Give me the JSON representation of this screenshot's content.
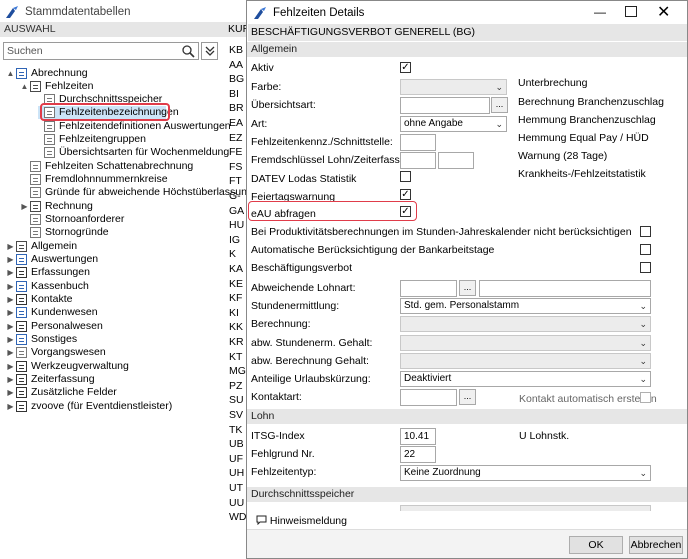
{
  "left_window": {
    "title": "Stammdatentabellen",
    "section": "AUSWAHL",
    "search_placeholder": "Suchen",
    "column_header": "KURZ"
  },
  "tree": [
    {
      "label": "Abrechnung",
      "icon": "book-icon",
      "expander": "▲"
    },
    {
      "label": "Fehlzeiten",
      "icon": "table-icon",
      "expander": "▲"
    },
    {
      "label": "Durchschnittsspeicher",
      "icon": "doc-icon",
      "expander": ""
    },
    {
      "label": "Fehlzeitenbezeichnungen",
      "icon": "doc-icon",
      "expander": ""
    },
    {
      "label": "Fehlzeitendefinitionen Auswertungen",
      "icon": "doc-icon",
      "expander": ""
    },
    {
      "label": "Fehlzeitengruppen",
      "icon": "doc-icon",
      "expander": ""
    },
    {
      "label": "Übersichtsarten für Wochenmeldung",
      "icon": "doc-icon",
      "expander": ""
    },
    {
      "label": "Fehlzeiten Schattenabrechnung",
      "icon": "doc-icon",
      "expander": ""
    },
    {
      "label": "Fremdlohnnummernkreise",
      "icon": "doc-icon",
      "expander": ""
    },
    {
      "label": "Gründe für abweichende Höchstüberlassungsdauer",
      "icon": "doc-icon",
      "expander": ""
    },
    {
      "label": "Rechnung",
      "icon": "table-icon",
      "expander": "▶"
    },
    {
      "label": "Stornoanforderer",
      "icon": "doc-icon",
      "expander": ""
    },
    {
      "label": "Stornogründe",
      "icon": "doc-icon",
      "expander": ""
    },
    {
      "label": "Allgemein",
      "icon": "table-icon",
      "expander": "▶"
    },
    {
      "label": "Auswertungen",
      "icon": "chart-icon",
      "expander": "▶"
    },
    {
      "label": "Erfassungen",
      "icon": "pen-icon",
      "expander": "▶"
    },
    {
      "label": "Kassenbuch",
      "icon": "cashbook-icon",
      "expander": "▶"
    },
    {
      "label": "Kontakte",
      "icon": "contact-icon",
      "expander": "▶"
    },
    {
      "label": "Kundenwesen",
      "icon": "customer-icon",
      "expander": "▶"
    },
    {
      "label": "Personalwesen",
      "icon": "person-icon",
      "expander": "▶"
    },
    {
      "label": "Sonstiges",
      "icon": "misc-icon",
      "expander": "▶"
    },
    {
      "label": "Vorgangswesen",
      "icon": "doc-icon",
      "expander": "▶"
    },
    {
      "label": "Werkzeugverwaltung",
      "icon": "tools-icon",
      "expander": "▶"
    },
    {
      "label": "Zeiterfassung",
      "icon": "clock-icon",
      "expander": "▶"
    },
    {
      "label": "Zusätzliche Felder",
      "icon": "fields-icon",
      "expander": "▶"
    },
    {
      "label": "zvoove (für Eventdienstleister)",
      "icon": "grid-icon",
      "expander": "▶"
    }
  ],
  "codes": [
    "KB",
    "AA",
    "BG",
    "BI",
    "BR",
    "EA",
    "EZ",
    "FE",
    "FS",
    "FT",
    "G-",
    "GA",
    "HU",
    "IG",
    "K",
    "KA",
    "KE",
    "KF",
    "KI",
    "KK",
    "KR",
    "KT",
    "MG",
    "PZ",
    "SU",
    "SV",
    "TK",
    "UB",
    "UF",
    "UH",
    "UT",
    "UU",
    "WD"
  ],
  "dialog": {
    "title": "Fehlzeiten Details",
    "header": "BESCHÄFTIGUNGSVERBOT GENERELL (BG)",
    "groups": {
      "allgemein": "Allgemein",
      "lohn": "Lohn",
      "durchschnitt": "Durchschnittsspeicher"
    },
    "labels": {
      "aktiv": "Aktiv",
      "farbe": "Farbe:",
      "uebersichtsart": "Übersichtsart:",
      "art": "Art:",
      "kenn": "Fehlzeitenkennz./Schnittstelle:",
      "fremd": "Fremdschlüssel Lohn/Zeiterfassung:",
      "datev": "DATEV Lodas Statistik",
      "feiertag": "Feiertagswarnung",
      "eau": "eAU abfragen",
      "produktiv": "Bei Produktivitätsberechnungen im Stunden-Jahreskalender nicht berücksichtigen",
      "bankarbeit": "Automatische Berücksichtigung der Bankarbeitstage",
      "bv": "Beschäftigungsverbot",
      "lohnart": "Abweichende Lohnart:",
      "stundenermittlung": "Stundenermittlung:",
      "berechnung": "Berechnung:",
      "abwstd": "abw. Stundenerm. Gehalt:",
      "abwber": "abw. Berechnung Gehalt:",
      "urlaub": "Anteilige Urlaubskürzung:",
      "kontaktart": "Kontaktart:",
      "kontakt_auto": "Kontakt automatisch erstellen",
      "itsg": "ITSG-Index",
      "fehlgrund": "Fehlgrund Nr.",
      "fehlzeitentyp": "Fehlzeitentyp:",
      "lohnstk": "U Lohnstk.",
      "durchschnitt_partial": "Durchschnittsspeicher"
    },
    "values": {
      "art": "ohne Angabe",
      "stundenermittlung": "Std. gem. Personalstamm",
      "urlaub": "Deaktiviert",
      "itsg": "10.41",
      "fehlgrund": "22",
      "fehlzeitentyp": "Keine Zuordnung"
    },
    "checks": {
      "aktiv": true,
      "datev": false,
      "feiertag": true,
      "eau": true,
      "produktiv": false,
      "bankarbeit": false,
      "bv": false,
      "kontakt_auto": false
    },
    "side": [
      "Unterbrechung",
      "Berechnung Branchenzuschlag",
      "Hemmung Branchenzuschlag",
      "Hemmung Equal Pay / HÜD",
      "Warnung (28 Tage)",
      "Krankheits-/Fehlzeitstatistik"
    ],
    "hint": "Hinweismeldung",
    "ok": "OK",
    "cancel": "Abbrechen",
    "ellipsis": "..."
  },
  "colors": {
    "highlight": "#e03c4a",
    "selection": "#cce4f7",
    "brand": "#1f4e9e"
  }
}
